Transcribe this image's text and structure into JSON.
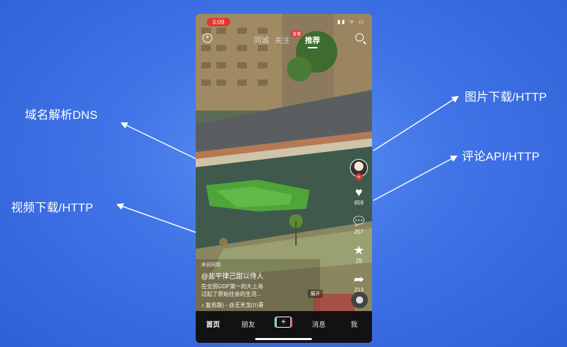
{
  "labels": {
    "dns": "域名解析DNS",
    "image": "图片下载/HTTP",
    "comment": "评论API/HTTP",
    "video": "视频下载/HTTP"
  },
  "status_bar": {
    "time": "3:09",
    "icons": "▮▮ ᯤ ▭"
  },
  "top_nav": {
    "tabs": [
      "同城",
      "关注",
      "推荐"
    ],
    "active": "推荐",
    "badge": "直播"
  },
  "side_rail": {
    "like_count": "659",
    "comment_count": "257",
    "favorite_count": "25",
    "share_count": "213"
  },
  "video_info": {
    "source": "来自同城",
    "author": "@盐平律己甜以侍人",
    "description_1": "在全国GDP第一的大上海",
    "description_2": "过起了原始社会的生活...",
    "music": "♪ 复苏版)  - @王天戈/川青",
    "expand": "展开"
  },
  "bottom_nav": {
    "home": "首页",
    "friends": "朋友",
    "plus": "+",
    "messages": "消息",
    "me": "我"
  },
  "colors": {
    "background": "#3f73e6",
    "accent_red": "#e2352f",
    "arrow": "#ffffff"
  },
  "icons": {
    "add": "add-circle-icon",
    "search": "search-icon",
    "like": "heart-icon",
    "comment": "comment-icon",
    "favorite": "star-icon",
    "share": "share-icon"
  }
}
